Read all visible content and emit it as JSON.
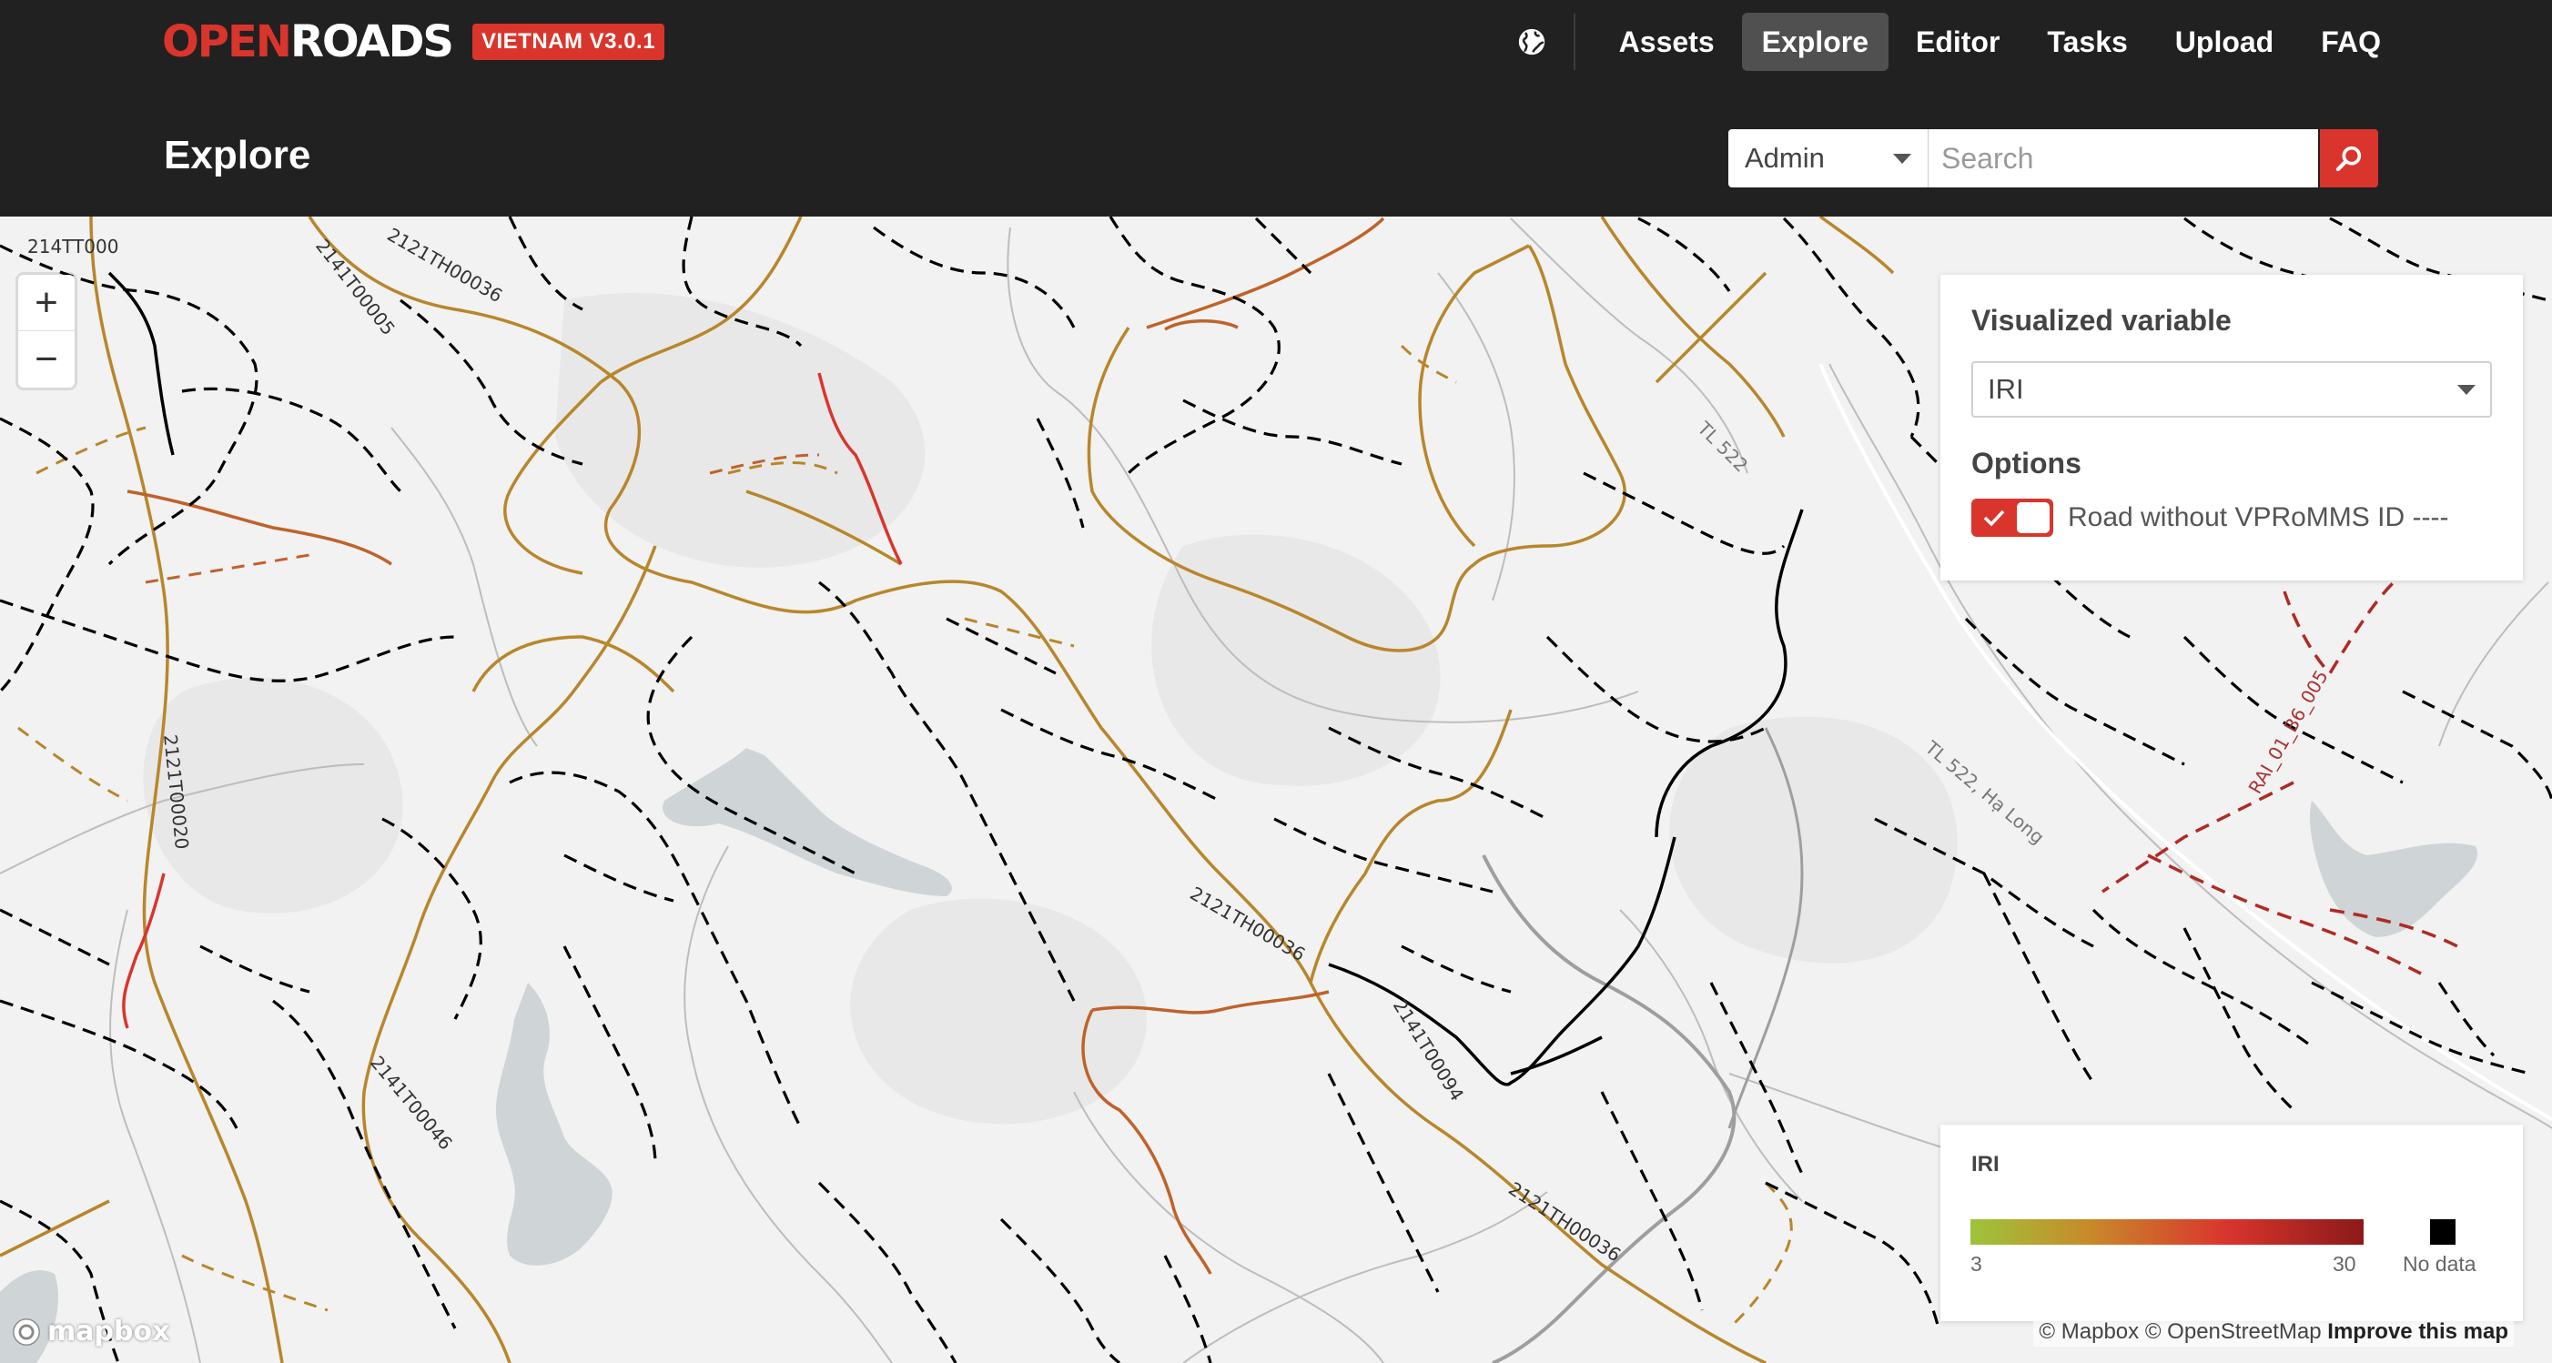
{
  "app": {
    "logo_part1": "OPEN",
    "logo_part2": "ROADS",
    "version": "VIETNAM V3.0.1"
  },
  "nav": {
    "items": [
      {
        "label": "Assets",
        "active": false
      },
      {
        "label": "Explore",
        "active": true
      },
      {
        "label": "Editor",
        "active": false
      },
      {
        "label": "Tasks",
        "active": false
      },
      {
        "label": "Upload",
        "active": false
      },
      {
        "label": "FAQ",
        "active": false
      }
    ],
    "language_icon": "globe-icon"
  },
  "page": {
    "title": "Explore"
  },
  "search": {
    "type_value": "Admin",
    "placeholder": "Search",
    "button_icon": "search-icon"
  },
  "panel": {
    "title": "Visualized variable",
    "variable_value": "IRI",
    "options_title": "Options",
    "option_label": "Road without VPRoMMS ID ----",
    "option_checked": true
  },
  "legend": {
    "title": "IRI",
    "min": "3",
    "max": "30",
    "no_data": "No data",
    "colors": {
      "low": "#9dc43a",
      "mid": "#c88a2a",
      "high": "#d9352c",
      "max": "#8b1a1a",
      "no_data": "#000000"
    }
  },
  "map": {
    "zoom_in": "+",
    "zoom_out": "−",
    "labels": [
      "214TT000",
      "2141T00005",
      "2121TH00036",
      "TL 522",
      "2121T00020",
      "2121TH00036",
      "TL 522, Hạ Long",
      "RAI_01_B6_005",
      "2141T00094",
      "2141T00046",
      "2121TH00036"
    ],
    "mapbox_logo": "mapbox",
    "attribution_1": "© Mapbox",
    "attribution_2": "© OpenStreetMap",
    "attribution_3": "Improve this map"
  },
  "colors": {
    "accent": "#d9352c",
    "topbar": "#212121",
    "road_good": "#b8862b",
    "road_mid": "#c0622a",
    "road_bad": "#d9352c",
    "road_nodata": "#000000"
  }
}
